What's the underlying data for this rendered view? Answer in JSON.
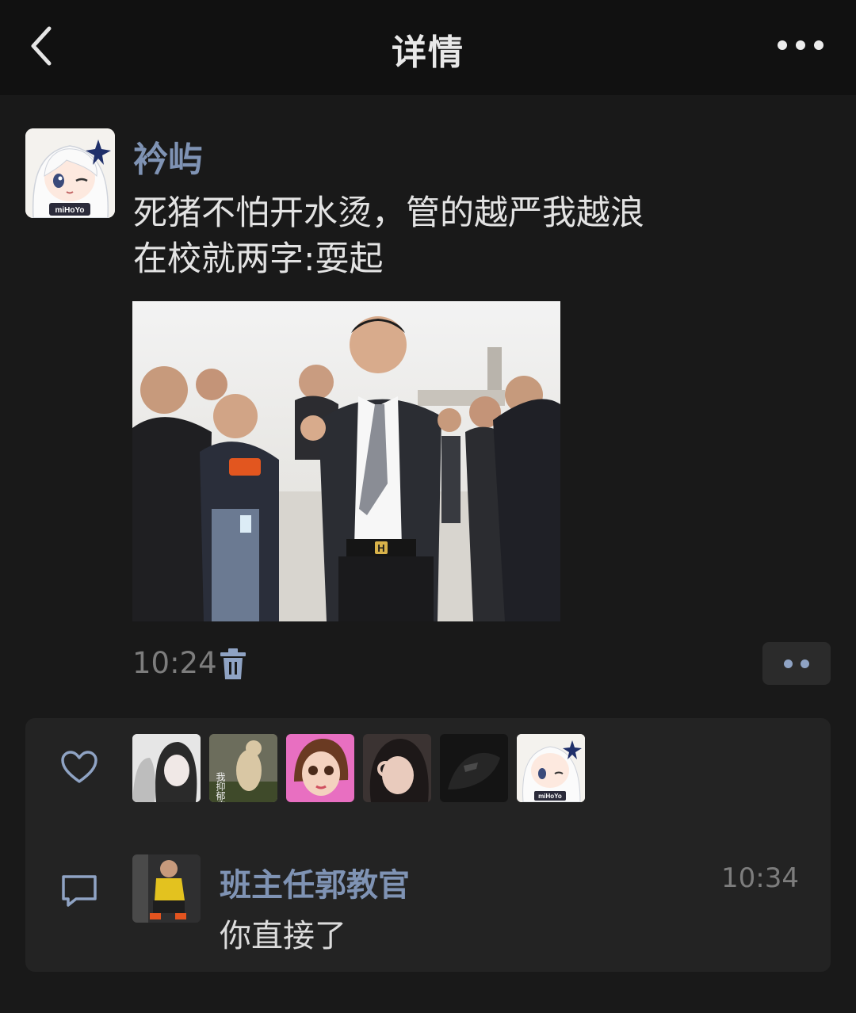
{
  "header": {
    "title": "详情",
    "back_icon": "chevron-left-icon",
    "more_icon": "more-dots-icon"
  },
  "post": {
    "author": "衿屿",
    "avatar_logo_text": "miHoYo",
    "text": "死猪不怕开水烫，管的越严我越浪\n在校就两字:耍起",
    "time": "10:24",
    "delete_icon": "trash-icon",
    "image_belt_letter": "H"
  },
  "likes": {
    "icon": "heart-icon",
    "avatars": [
      {
        "name": "liker-avatar-1"
      },
      {
        "name": "liker-avatar-2",
        "caption": "我抑郁症"
      },
      {
        "name": "liker-avatar-3"
      },
      {
        "name": "liker-avatar-4"
      },
      {
        "name": "liker-avatar-5"
      },
      {
        "name": "liker-avatar-6",
        "logo": "miHoYo"
      }
    ]
  },
  "comments": [
    {
      "icon": "comment-icon",
      "name": "班主任郭教官",
      "time": "10:34",
      "text": "你直接了"
    }
  ],
  "colors": {
    "background": "#191919",
    "topbar": "#111111",
    "link": "#7f93b4",
    "panel": "#232323"
  }
}
